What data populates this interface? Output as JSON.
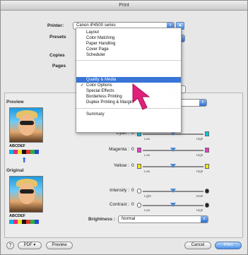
{
  "window": {
    "title": "Print"
  },
  "printer": {
    "label": "Printer:",
    "value": "Canon iP4500 series"
  },
  "presets": {
    "label": "Presets"
  },
  "copies": {
    "label": "Copies"
  },
  "pages": {
    "label": "Pages"
  },
  "menu": {
    "group1": [
      "Layout",
      "Color Matching",
      "Paper Handling",
      "Cover Page",
      "Scheduler"
    ],
    "group2": [
      {
        "label": "Quality & Media",
        "checked": false,
        "highlighted": true
      },
      {
        "label": "Color Options",
        "checked": true,
        "highlighted": false
      },
      {
        "label": "Special Effects",
        "checked": false,
        "highlighted": false
      },
      {
        "label": "Borderless Printing",
        "checked": false,
        "highlighted": false
      },
      {
        "label": "Duplex Printing & Margin",
        "checked": false,
        "highlighted": false
      }
    ],
    "group3": [
      "Summary"
    ]
  },
  "preview": {
    "label": "Preview",
    "sample_text": "ABCDEF"
  },
  "original": {
    "label": "Original",
    "sample_text": "ABCDEF"
  },
  "color_sliders": [
    {
      "name": "Cyan :",
      "value": "0",
      "low": "Low",
      "high": "High",
      "color": "#00c8e6",
      "level": 0.5
    },
    {
      "name": "Magenta :",
      "value": "0",
      "low": "Low",
      "high": "High",
      "color": "#e63cc8",
      "level": 0.5
    },
    {
      "name": "Yellow :",
      "value": "0",
      "low": "Low",
      "high": "High",
      "color": "#f0e61e",
      "level": 0.5
    }
  ],
  "tone_sliders": [
    {
      "name": "Intensity :",
      "value": "0",
      "low": "Light",
      "high": "Dark",
      "level": 0.5
    },
    {
      "name": "Contrast :",
      "value": "0",
      "low": "Low",
      "high": "High",
      "level": 0.5
    }
  ],
  "brightness": {
    "label": "Brightness :",
    "value": "Normal"
  },
  "buttons": {
    "help": "?",
    "pdf": "PDF ▾",
    "preview": "Preview",
    "cancel": "Cancel",
    "print": "Print"
  },
  "colors": {
    "highlight": "#3875d7",
    "accent": "#4a8fe8",
    "pointer": "#e0207a"
  }
}
